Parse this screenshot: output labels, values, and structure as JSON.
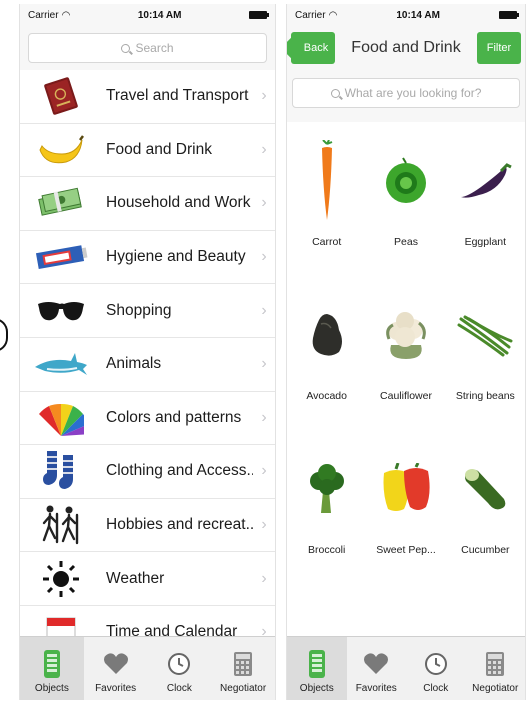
{
  "left": {
    "status": {
      "carrier": "Carrier",
      "time": "10:14 AM"
    },
    "search": {
      "placeholder": "Search"
    },
    "categories": [
      {
        "label": "Travel and Transport",
        "icon": "passport-icon"
      },
      {
        "label": "Food and Drink",
        "icon": "banana-icon"
      },
      {
        "label": "Household and Work",
        "icon": "cash-icon"
      },
      {
        "label": "Hygiene and Beauty",
        "icon": "toothpaste-icon"
      },
      {
        "label": "Shopping",
        "icon": "sunglasses-icon"
      },
      {
        "label": "Animals",
        "icon": "shark-icon"
      },
      {
        "label": "Colors and patterns",
        "icon": "color-swatches-icon"
      },
      {
        "label": "Clothing and Access...",
        "icon": "socks-icon"
      },
      {
        "label": "Hobbies and recreat...",
        "icon": "hikers-icon"
      },
      {
        "label": "Weather",
        "icon": "sun-icon"
      },
      {
        "label": "Time and Calendar",
        "icon": "calendar-icon"
      }
    ],
    "tabs": [
      {
        "label": "Objects",
        "icon": "phone-list-icon",
        "active": true
      },
      {
        "label": "Favorites",
        "icon": "heart-icon",
        "active": false
      },
      {
        "label": "Clock",
        "icon": "clock-icon",
        "active": false
      },
      {
        "label": "Negotiator",
        "icon": "calculator-icon",
        "active": false
      }
    ]
  },
  "right": {
    "status": {
      "carrier": "Carrier",
      "time": "10:14 AM"
    },
    "nav": {
      "back_label": "Back",
      "title": "Food and Drink",
      "filter_label": "Filter"
    },
    "search": {
      "placeholder": "What are you looking for?"
    },
    "items": [
      {
        "label": "Carrot",
        "icon": "carrot-icon"
      },
      {
        "label": "Peas",
        "icon": "peas-icon"
      },
      {
        "label": "Eggplant",
        "icon": "eggplant-icon"
      },
      {
        "label": "Avocado",
        "icon": "avocado-icon"
      },
      {
        "label": "Cauliflower",
        "icon": "cauliflower-icon"
      },
      {
        "label": "String beans",
        "icon": "string-beans-icon"
      },
      {
        "label": "Broccoli",
        "icon": "broccoli-icon"
      },
      {
        "label": "Sweet Pep...",
        "icon": "sweet-pepper-icon"
      },
      {
        "label": "Cucumber",
        "icon": "cucumber-icon"
      }
    ],
    "tabs": [
      {
        "label": "Objects",
        "icon": "phone-list-icon",
        "active": true
      },
      {
        "label": "Favorites",
        "icon": "heart-icon",
        "active": false
      },
      {
        "label": "Clock",
        "icon": "clock-icon",
        "active": false
      },
      {
        "label": "Negotiator",
        "icon": "calculator-icon",
        "active": false
      }
    ]
  },
  "colors": {
    "accent_green": "#4ab34a",
    "separator": "#e6e6e6",
    "tab_active_bg": "#dcdcdc"
  }
}
